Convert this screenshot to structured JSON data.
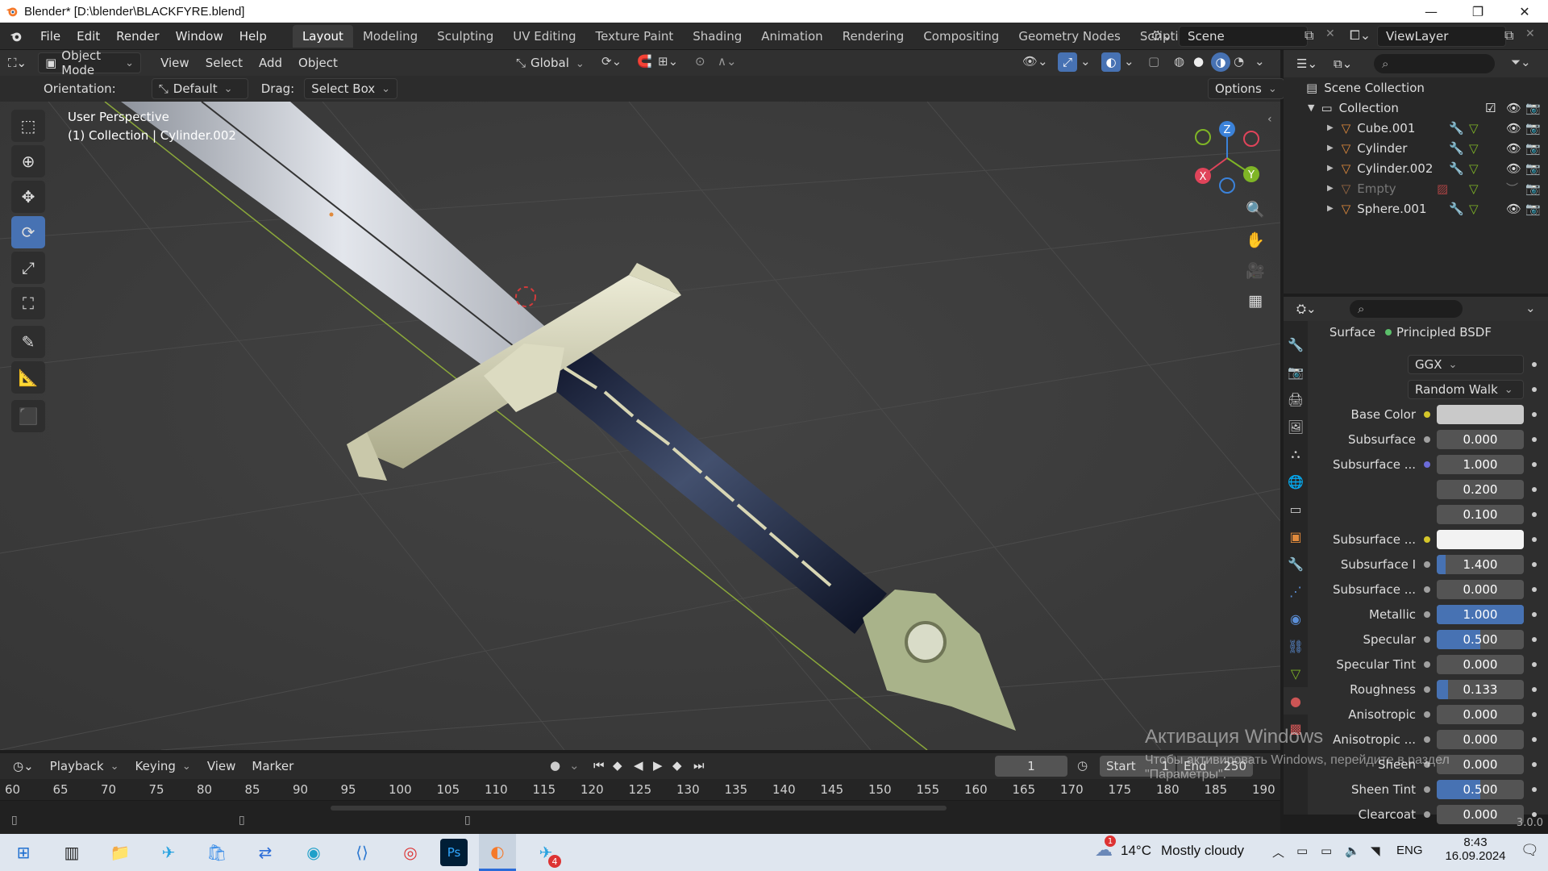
{
  "window": {
    "title": "Blender* [D:\\blender\\BLACKFYRE.blend]",
    "minimize": "—",
    "maximize": "❐",
    "close": "✕"
  },
  "menubar": {
    "items": [
      "File",
      "Edit",
      "Render",
      "Window",
      "Help"
    ],
    "workspaces": [
      "Layout",
      "Modeling",
      "Sculpting",
      "UV Editing",
      "Texture Paint",
      "Shading",
      "Animation",
      "Rendering",
      "Compositing",
      "Geometry Nodes",
      "Scripting"
    ],
    "active_workspace": "Layout",
    "add_tab": "+",
    "scene": "Scene",
    "view_layer": "ViewLayer"
  },
  "viewport_header": {
    "mode": "Object Mode",
    "menus": [
      "View",
      "Select",
      "Add",
      "Object"
    ],
    "transform": "Global",
    "orientation_label": "Orientation:",
    "orientation_value": "Default",
    "drag_label": "Drag:",
    "drag_value": "Select Box",
    "options": "Options"
  },
  "viewport": {
    "perspective": "User Perspective",
    "collection_info": "(1) Collection | Cylinder.002",
    "gizmo": {
      "z": "Z",
      "x": "X",
      "y": "Y"
    }
  },
  "outliner": {
    "root": "Scene Collection",
    "collection": "Collection",
    "objects": [
      {
        "name": "Cube.001",
        "dim": false
      },
      {
        "name": "Cylinder",
        "dim": false
      },
      {
        "name": "Cylinder.002",
        "dim": false
      },
      {
        "name": "Empty",
        "dim": true
      },
      {
        "name": "Sphere.001",
        "dim": false
      }
    ]
  },
  "properties": {
    "surface_label": "Surface",
    "surface_value": "Principled BSDF",
    "distribution": "GGX",
    "subsurface_method": "Random Walk",
    "rows": [
      {
        "label": "Base Color",
        "value": "",
        "kind": "color",
        "color": "#c9c9c9",
        "dot": "#d4c62a"
      },
      {
        "label": "Subsurface",
        "value": "0.000",
        "kind": "num",
        "fill": 0
      },
      {
        "label": "Subsurface ...",
        "value": "1.000",
        "kind": "num",
        "fill": 0,
        "dot": "#6c6cd8"
      },
      {
        "label": "",
        "value": "0.200",
        "kind": "num",
        "fill": 0,
        "nodot": true
      },
      {
        "label": "",
        "value": "0.100",
        "kind": "num",
        "fill": 0,
        "nodot": true
      },
      {
        "label": "Subsurface ...",
        "value": "",
        "kind": "color",
        "color": "#f2f2f2",
        "dot": "#d4c62a"
      },
      {
        "label": "Subsurface I",
        "value": "1.400",
        "kind": "num",
        "fill": 0.1
      },
      {
        "label": "Subsurface ...",
        "value": "0.000",
        "kind": "num",
        "fill": 0
      },
      {
        "label": "Metallic",
        "value": "1.000",
        "kind": "num",
        "fill": 1.0
      },
      {
        "label": "Specular",
        "value": "0.500",
        "kind": "num",
        "fill": 0.5
      },
      {
        "label": "Specular Tint",
        "value": "0.000",
        "kind": "num",
        "fill": 0
      },
      {
        "label": "Roughness",
        "value": "0.133",
        "kind": "num",
        "fill": 0.133
      },
      {
        "label": "Anisotropic",
        "value": "0.000",
        "kind": "num",
        "fill": 0
      },
      {
        "label": "Anisotropic ...",
        "value": "0.000",
        "kind": "num",
        "fill": 0
      },
      {
        "label": "Sheen",
        "value": "0.000",
        "kind": "num",
        "fill": 0
      },
      {
        "label": "Sheen Tint",
        "value": "0.500",
        "kind": "num",
        "fill": 0.5
      },
      {
        "label": "Clearcoat",
        "value": "0.000",
        "kind": "num",
        "fill": 0
      }
    ],
    "version": "3.0.0"
  },
  "timeline": {
    "menus": [
      "Playback",
      "Keying",
      "View",
      "Marker"
    ],
    "current_frame": "1",
    "start_label": "Start",
    "start_value": "1",
    "end_label": "End",
    "end_value": "250",
    "ticks": [
      "60",
      "65",
      "70",
      "75",
      "80",
      "85",
      "90",
      "95",
      "100",
      "105",
      "110",
      "115",
      "120",
      "125",
      "130",
      "135",
      "140",
      "145",
      "150",
      "155",
      "160",
      "165",
      "170",
      "175",
      "180",
      "185",
      "190"
    ]
  },
  "watermark": {
    "line1": "Активация Windows",
    "line2": "Чтобы активировать Windows, перейдите в раздел",
    "line3": "\"Параметры\"."
  },
  "taskbar": {
    "weather_temp": "14°C",
    "weather_desc": "Mostly cloudy",
    "lang": "ENG",
    "time": "8:43",
    "date": "16.09.2024",
    "notification_badge": "1",
    "telegram_badge": "4"
  },
  "colors": {
    "accent": "#4772b3",
    "viewport_bg": "#3d3d3d",
    "object_orange": "#e08a3c",
    "gizmo_x": "#e0445a",
    "gizmo_y": "#7fb526",
    "gizmo_z": "#3b82d9"
  }
}
